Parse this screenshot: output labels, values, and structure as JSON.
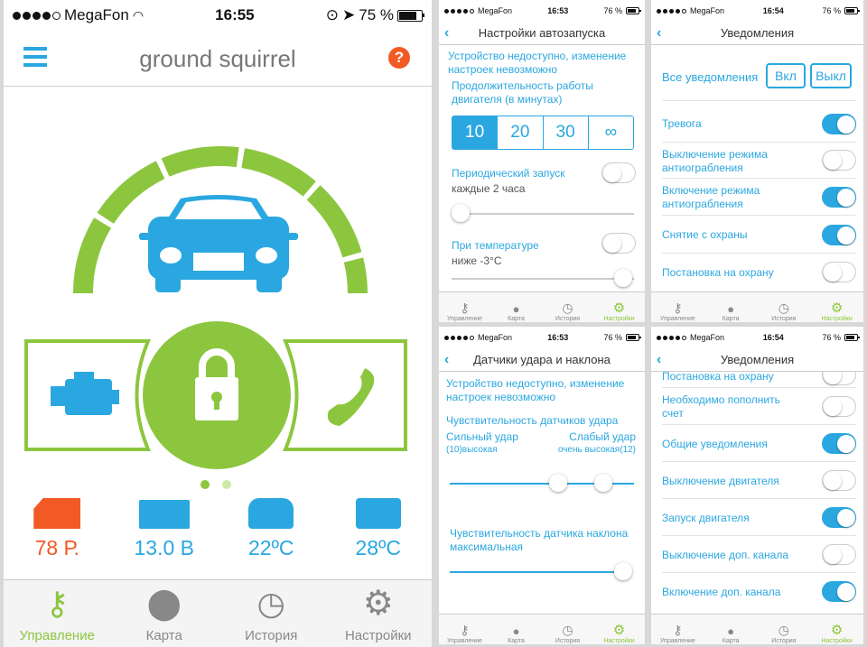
{
  "colors": {
    "accent": "#8cc63f",
    "blue": "#2aa7e0",
    "orange": "#f15a24"
  },
  "main": {
    "status": {
      "carrier": "MegaFon",
      "time": "16:55",
      "battery": "75 %"
    },
    "title": "ground squirrel",
    "stats": [
      {
        "icon": "balance-icon",
        "value": "78 Р."
      },
      {
        "icon": "battery-icon",
        "value": "13.0 В"
      },
      {
        "icon": "car-temp-icon",
        "value": "22ºC"
      },
      {
        "icon": "engine-temp-icon",
        "value": "28ºC"
      }
    ],
    "tabs": [
      "Управление",
      "Карта",
      "История",
      "Настройки"
    ]
  },
  "autostart": {
    "status": {
      "carrier": "MegaFon",
      "time": "16:53",
      "battery": "76 %"
    },
    "title": "Настройки автозапуска",
    "notice": "Устройство недоступно, изменение настроек невозможно",
    "duration_label": "Продолжительность работы двигателя (в минутах)",
    "durations": [
      "10",
      "20",
      "30",
      "∞"
    ],
    "periodic_label": "Периодический запуск",
    "periodic_sub": "каждые 2 часа",
    "temp_label": "При температуре",
    "temp_sub": "ниже -3°C",
    "tabs": [
      "Управление",
      "Карта",
      "История",
      "Настройки"
    ]
  },
  "sensors": {
    "status": {
      "carrier": "MegaFon",
      "time": "16:53",
      "battery": "76 %"
    },
    "title": "Датчики удара и наклона",
    "notice": "Устройство недоступно, изменение настроек невозможно",
    "shock_label": "Чувствительность датчиков удара",
    "strong": "Сильный удар",
    "strong_sub": "(10)высокая",
    "weak": "Слабый удар",
    "weak_sub": "очень высокая(12)",
    "tilt_label": "Чувствительность датчика наклона максимальная",
    "tabs": [
      "Управление",
      "Карта",
      "История",
      "Настройки"
    ]
  },
  "notif1": {
    "status": {
      "carrier": "MegaFon",
      "time": "16:54",
      "battery": "76 %"
    },
    "title": "Уведомления",
    "all_label": "Все уведомления",
    "on_btn": "Вкл",
    "off_btn": "Выкл",
    "items": [
      {
        "label": "Тревога",
        "on": true
      },
      {
        "label": "Выключение режима антиограбления",
        "on": false
      },
      {
        "label": "Включение режима антиограбления",
        "on": true
      },
      {
        "label": "Снятие с охраны",
        "on": true
      },
      {
        "label": "Постановка на охрану",
        "on": false
      }
    ],
    "tabs": [
      "Управление",
      "Карта",
      "История",
      "Настройки"
    ]
  },
  "notif2": {
    "status": {
      "carrier": "MegaFon",
      "time": "16:54",
      "battery": "76 %"
    },
    "title": "Уведомления",
    "items": [
      {
        "label": "Постановка на охрану",
        "on": false
      },
      {
        "label": "Необходимо пополнить счет",
        "on": false
      },
      {
        "label": "Общие уведомления",
        "on": true
      },
      {
        "label": "Выключение двигателя",
        "on": false
      },
      {
        "label": "Запуск двигателя",
        "on": true
      },
      {
        "label": "Выключение доп. канала",
        "on": false
      },
      {
        "label": "Включение доп. канала",
        "on": true
      }
    ],
    "tabs": [
      "Управление",
      "Карта",
      "История",
      "Настройки"
    ]
  }
}
